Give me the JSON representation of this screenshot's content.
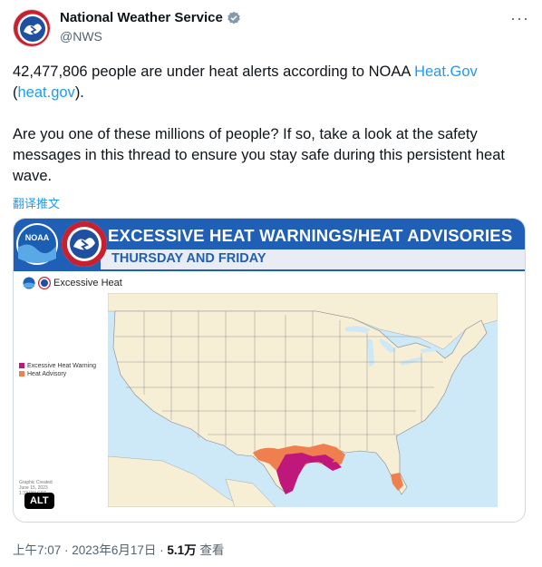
{
  "author": {
    "name": "National Weather Service",
    "handle": "@NWS"
  },
  "tweet": {
    "line1_prefix": "42,477,806 people are under heat alerts according to  NOAA ",
    "line1_link": "Heat.Gov",
    "line2_open": "(",
    "line2_link": "heat.gov",
    "line2_close": ").",
    "paragraph2": "Are you one of these millions of people? If so, take a look at the safety messages in this thread to ensure you stay safe during this persistent heat wave.",
    "translate_label": "翻译推文"
  },
  "image": {
    "banner_title": "EXCESSIVE HEAT WARNINGS/HEAT ADVISORIES",
    "banner_subtitle": "THURSDAY AND FRIDAY",
    "map_header": "Excessive Heat",
    "legend": [
      {
        "label": "Excessive Heat Warning",
        "color": "#c0187a"
      },
      {
        "label": "Heat Advisory",
        "color": "#f07f4f"
      }
    ],
    "credit_lines": [
      "Graphic Created",
      "June 15, 2023",
      "1:33 PM CDT"
    ],
    "alt_label": "ALT",
    "colors": {
      "banner_blue": "#1f5fb5",
      "land": "#f6efd6",
      "water": "#cde8f6",
      "warning": "#c0187a",
      "advisory": "#f07f4f"
    }
  },
  "meta": {
    "time": "上午7:07",
    "sep1": " · ",
    "date": "2023年6月17日",
    "sep2": " · ",
    "views_count": "5.1万",
    "views_label": " 查看"
  }
}
